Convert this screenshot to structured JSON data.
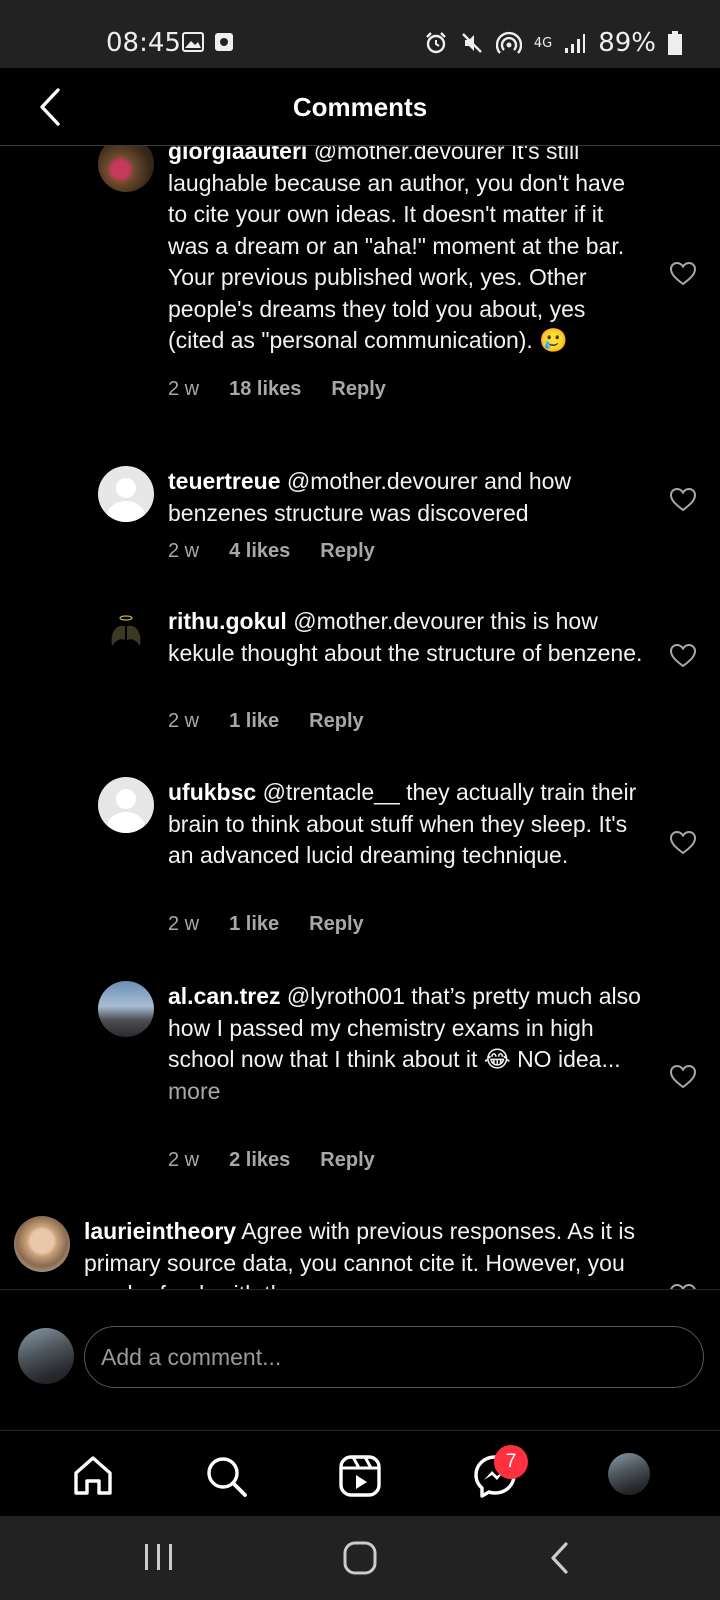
{
  "status": {
    "time": "08:45",
    "network": "4G",
    "battery": "89%"
  },
  "header": {
    "title": "Comments"
  },
  "comments": [
    {
      "user": "giorgiaauteri",
      "text": " @mother.devourer It's still laughable because an author, you don't have to cite your own ideas. It doesn't matter if it was a dream or an \"aha!\" moment at the bar. Your previous published work, yes. Other people's dreams they told you about, yes (cited as \"personal communication). 🥲",
      "time": "2 w",
      "likes": "18 likes",
      "reply": "Reply"
    },
    {
      "user": "teuertreue",
      "text": " @mother.devourer and how benzenes structure was discovered",
      "time": "2 w",
      "likes": "4 likes",
      "reply": "Reply"
    },
    {
      "user": "rithu.gokul",
      "text": " @mother.devourer this is how kekule thought about the structure of benzene.",
      "time": "2 w",
      "likes": "1 like",
      "reply": "Reply"
    },
    {
      "user": "ufukbsc",
      "text": " @trentacle__ they actually train their brain to think about stuff when they sleep. It's an advanced lucid dreaming technique.",
      "time": "2 w",
      "likes": "1 like",
      "reply": "Reply"
    },
    {
      "user": "al.can.trez",
      "text": " @lyroth001 that’s pretty much also how I passed my chemistry exams in high school now that I think about it 😂 NO idea...",
      "more": "more",
      "time": "2 w",
      "likes": "2 likes",
      "reply": "Reply"
    },
    {
      "user": "laurieintheory",
      "text": " Agree with previous responses. As it is primary source data, you cannot cite it. However, you can be frank with the"
    }
  ],
  "composer": {
    "placeholder": "Add a comment..."
  },
  "nav": {
    "messages_badge": "7"
  },
  "icons": {
    "back": "back-arrow-icon",
    "heart": "heart-outline-icon",
    "home": "home-icon",
    "search": "search-icon",
    "reels": "reels-icon",
    "messenger": "messenger-icon"
  }
}
